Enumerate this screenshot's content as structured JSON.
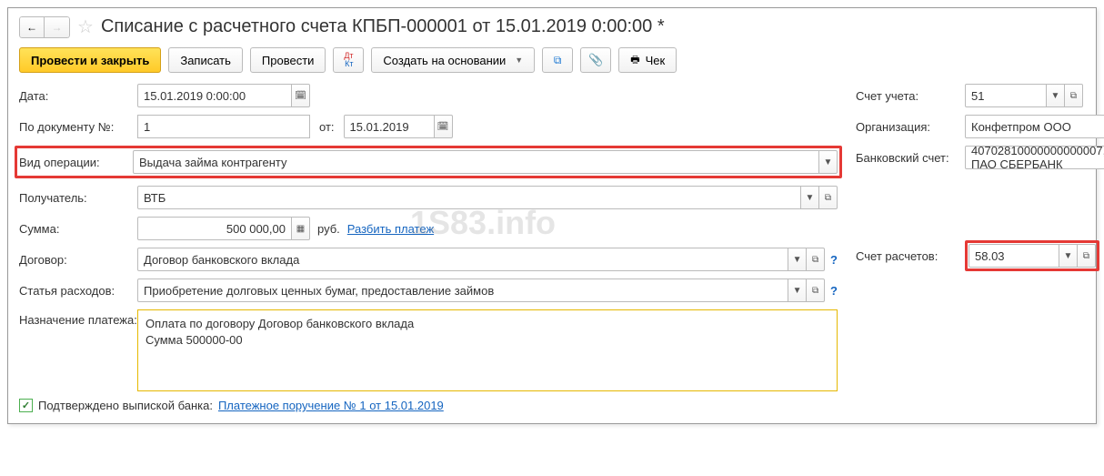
{
  "header": {
    "title": "Списание с расчетного счета КПБП-000001 от 15.01.2019 0:00:00 *"
  },
  "toolbar": {
    "post_close": "Провести и закрыть",
    "save": "Записать",
    "post": "Провести",
    "create_based": "Создать на основании",
    "cheque": "Чек"
  },
  "labels": {
    "date": "Дата:",
    "doc_num": "По документу №:",
    "doc_from": "от:",
    "op_type": "Вид операции:",
    "recipient": "Получатель:",
    "amount": "Сумма:",
    "currency": "руб.",
    "split": "Разбить платеж",
    "contract": "Договор:",
    "expense_item": "Статья расходов:",
    "purpose": "Назначение платежа:",
    "account": "Счет учета:",
    "org": "Организация:",
    "bank_account": "Банковский счет:",
    "settle_account": "Счет расчетов:",
    "confirmed": "Подтверждено выпиской банка:",
    "payment_order": "Платежное поручение № 1 от 15.01.2019"
  },
  "values": {
    "date": "15.01.2019  0:00:00",
    "doc_num": "1",
    "doc_date": "15.01.2019",
    "op_type": "Выдача займа контрагенту",
    "recipient": "ВТБ",
    "amount": "500 000,00",
    "contract": "Договор банковского вклада",
    "expense_item": "Приобретение долговых ценных бумаг, предоставление займов",
    "purpose_l1": "Оплата по договору Договор банковского вклада",
    "purpose_l2": "Сумма 500000-00",
    "account": "51",
    "org": "Конфетпром ООО",
    "bank_account": "40702810000000000007, ПАО СБЕРБАНК",
    "settle_account": "58.03"
  },
  "watermark": "1S83.info"
}
